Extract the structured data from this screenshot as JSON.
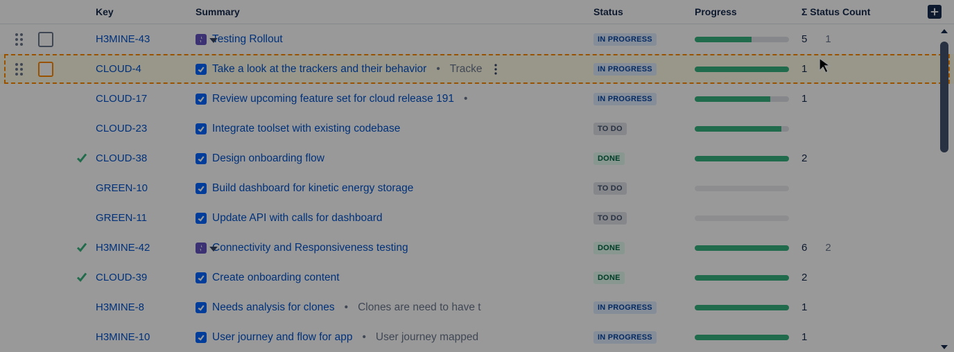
{
  "columns": {
    "key": "Key",
    "summary": "Summary",
    "status": "Status",
    "progress": "Progress",
    "count": "Σ Status Count"
  },
  "status_labels": {
    "inprogress": "IN PROGRESS",
    "todo": "TO DO",
    "done": "DONE"
  },
  "rows": [
    {
      "key": "H3MINE-43",
      "type": "epic",
      "expandable": true,
      "drag": true,
      "checkbox": true,
      "summary": "Testing Rollout",
      "status": "inprogress",
      "progress_green": 60,
      "progress_blue": 0,
      "count1": "5",
      "count2": "1"
    },
    {
      "key": "CLOUD-4",
      "type": "task",
      "dragging": true,
      "drag": true,
      "checkbox": true,
      "more": true,
      "summary": "Take a look at the trackers and their behavior",
      "extra": "Tracke",
      "status": "inprogress",
      "progress_green": 100,
      "progress_blue": 0,
      "count1": "1"
    },
    {
      "key": "CLOUD-17",
      "type": "task",
      "summary": "Review upcoming feature set for cloud release 191",
      "extra": "",
      "trailing_dot": true,
      "status": "inprogress",
      "progress_green": 80,
      "progress_blue": 0,
      "count1": "1"
    },
    {
      "key": "CLOUD-23",
      "type": "task",
      "summary": "Integrate toolset with existing codebase",
      "status": "todo",
      "progress_green": 92,
      "progress_blue": 0
    },
    {
      "key": "CLOUD-38",
      "type": "task",
      "done": true,
      "summary": "Design onboarding flow",
      "status": "done",
      "progress_green": 100,
      "progress_blue": 0,
      "count1": "2"
    },
    {
      "key": "GREEN-10",
      "type": "task",
      "summary": "Build dashboard for kinetic energy storage",
      "status": "todo",
      "progress_ghost": true
    },
    {
      "key": "GREEN-11",
      "type": "task",
      "summary": "Update API with calls for dashboard",
      "status": "todo",
      "progress_ghost": true
    },
    {
      "key": "H3MINE-42",
      "type": "epic",
      "expandable": true,
      "done": true,
      "summary": "Connectivity and Responsiveness testing",
      "status": "done",
      "progress_green": 100,
      "progress_blue": 0,
      "count1": "6",
      "count2": "2"
    },
    {
      "key": "CLOUD-39",
      "type": "task",
      "done": true,
      "summary": "Create onboarding content",
      "status": "done",
      "progress_green": 100,
      "progress_blue": 0,
      "count1": "2"
    },
    {
      "key": "H3MINE-8",
      "type": "task",
      "summary": "Needs analysis for clones",
      "extra": "Clones are need to have t",
      "status": "inprogress",
      "progress_green": 100,
      "progress_blue": 0,
      "count1": "1"
    },
    {
      "key": "H3MINE-10",
      "type": "task",
      "summary": "User journey and flow for app",
      "extra": "User journey mapped",
      "status": "inprogress",
      "progress_green": 100,
      "progress_blue": 0,
      "count1": "1"
    }
  ]
}
